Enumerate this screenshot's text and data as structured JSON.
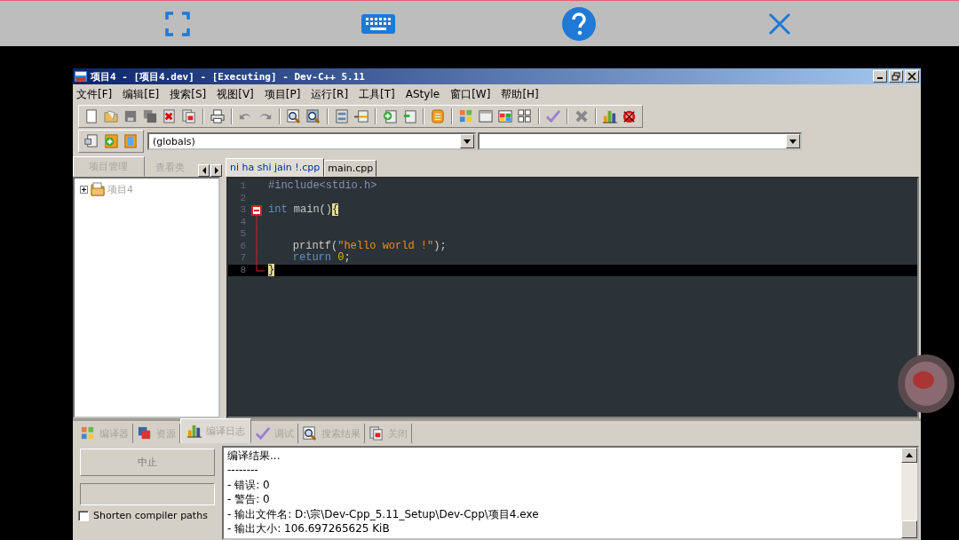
{
  "window": {
    "title": "项目4 - [项目4.dev] - [Executing] - Dev-C++ 5.11"
  },
  "menu": [
    "文件[F]",
    "编辑[E]",
    "搜索[S]",
    "视图[V]",
    "项目[P]",
    "运行[R]",
    "工具[T]",
    "AStyle",
    "窗口[W]",
    "帮助[H]"
  ],
  "scope_combo": {
    "value": "(globals)"
  },
  "left_tabs": [
    {
      "label": "项目管理",
      "selected": true
    },
    {
      "label": "查看类",
      "selected": false
    }
  ],
  "project_tree": [
    {
      "label": "项目4",
      "expanded": false
    }
  ],
  "editor_tabs": [
    {
      "label": "ni ha shi jain !.cpp",
      "selected": true
    },
    {
      "label": "main.cpp",
      "selected": false
    }
  ],
  "code_lines": [
    {
      "number": "1",
      "kind": "plain",
      "current": false,
      "tokens": [
        {
          "kind": "preproc",
          "text": "#include<stdio.h>"
        }
      ]
    },
    {
      "number": "2",
      "kind": "plain",
      "current": false
    },
    {
      "number": "3",
      "kind": "fold-start",
      "current": false,
      "tokens": [
        {
          "kind": "keyword",
          "text": "int"
        },
        {
          "kind": "plain",
          "text": " main()"
        },
        {
          "kind": "brace",
          "text": "{"
        }
      ]
    },
    {
      "number": "4",
      "kind": "fold-body",
      "current": false
    },
    {
      "number": "5",
      "kind": "fold-body",
      "current": false
    },
    {
      "number": "6",
      "kind": "fold-body",
      "indented": true,
      "current": false,
      "tokens": [
        {
          "kind": "plain",
          "text": "printf("
        },
        {
          "kind": "string",
          "text": "\"hello world !\""
        },
        {
          "kind": "plain",
          "text": ");"
        }
      ]
    },
    {
      "number": "7",
      "kind": "fold-body",
      "indented": true,
      "current": false,
      "tokens": [
        {
          "kind": "keyword",
          "text": "return"
        },
        {
          "kind": "number",
          "text": "0"
        },
        {
          "kind": "plain",
          "text": ";"
        }
      ]
    },
    {
      "number": "8",
      "kind": "fold-end",
      "current": true,
      "tokens": [
        {
          "kind": "brace",
          "text": "}"
        }
      ]
    }
  ],
  "bottom_tabs": [
    {
      "label": "编译器",
      "selected": false
    },
    {
      "label": "资源",
      "selected": false
    },
    {
      "label": "编译日志",
      "selected": true
    },
    {
      "label": "调试",
      "selected": false
    },
    {
      "label": "搜索结果",
      "selected": false
    },
    {
      "label": "关闭",
      "selected": false
    }
  ],
  "compile_panel": {
    "abort_button": {
      "label": "中止",
      "disabled": true
    },
    "shorten_paths": {
      "label": "Shorten compiler paths",
      "checked": false
    }
  },
  "log_lines": [
    "编译结果...",
    "--------",
    "- 错误: 0",
    "- 警告: 0",
    "- 输出文件名: D:\\宗\\Dev-Cpp_5.11_Setup\\Dev-Cpp\\项目4.exe",
    "- 输出大小: 106.697265625 KiB"
  ]
}
